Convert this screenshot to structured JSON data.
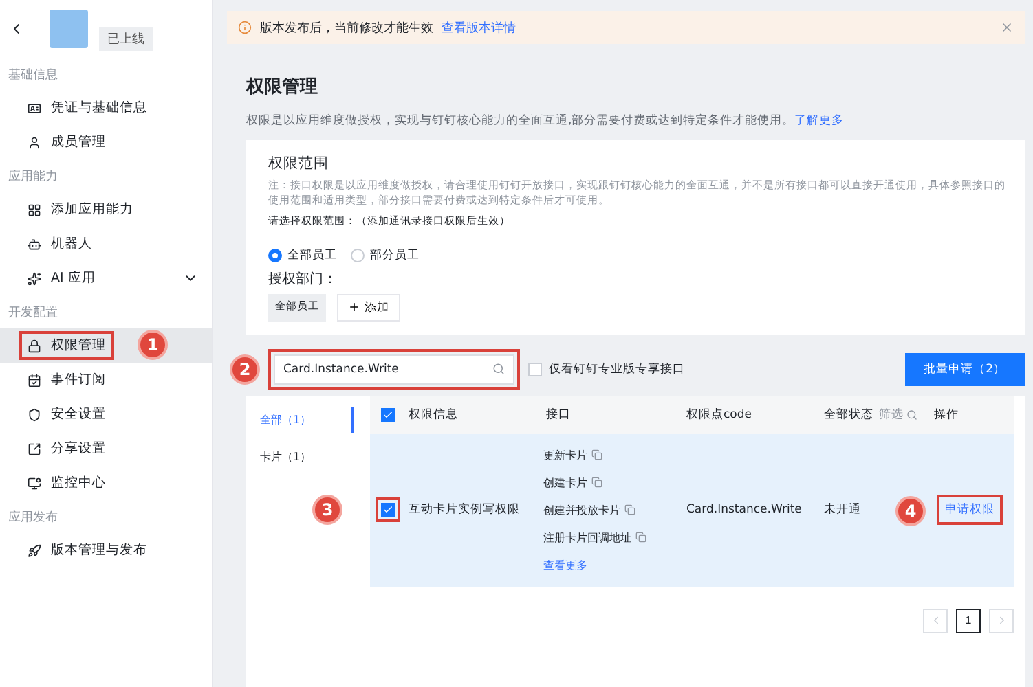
{
  "sidebar": {
    "app_status": "已上线",
    "sections": [
      {
        "title": "基础信息",
        "items": [
          {
            "label": "凭证与基础信息",
            "selected": false
          },
          {
            "label": "成员管理",
            "selected": false
          }
        ]
      },
      {
        "title": "应用能力",
        "items": [
          {
            "label": "添加应用能力",
            "selected": false
          },
          {
            "label": "机器人",
            "selected": false
          },
          {
            "label": "AI 应用",
            "selected": false,
            "expanded": false
          }
        ]
      },
      {
        "title": "开发配置",
        "items": [
          {
            "label": "权限管理",
            "selected": true,
            "callout": "1"
          },
          {
            "label": "事件订阅",
            "selected": false
          },
          {
            "label": "安全设置",
            "selected": false
          },
          {
            "label": "分享设置",
            "selected": false
          },
          {
            "label": "监控中心",
            "selected": false
          }
        ]
      },
      {
        "title": "应用发布",
        "items": [
          {
            "label": "版本管理与发布",
            "selected": false
          }
        ]
      }
    ]
  },
  "notice": {
    "text": "版本发布后，当前修改才能生效",
    "link": "查看版本详情"
  },
  "page": {
    "title": "权限管理",
    "description": "权限是以应用维度做授权，实现与钉钉核心能力的全面互通,部分需要付费或达到特定条件才能使用。",
    "link": "了解更多"
  },
  "scope": {
    "title": "权限范围",
    "note": "注：接口权限是以应用维度做授权，请合理使用钉钉开放接口，实现跟钉钉核心能力的全面互通，并不是所有接口都可以直接开通使用，具体参照接口的使用范围和适用类型，部分接口需要付费或达到特定条件后才可使用。",
    "prompt": "请选择权限范围：（添加通讯录接口权限后生效）",
    "options": [
      {
        "label": "全部员工",
        "selected": true
      },
      {
        "label": "部分员工",
        "selected": false
      }
    ],
    "dept_label": "授权部门：",
    "dept_tags": [
      "全部员工"
    ],
    "add_button": "添加"
  },
  "filter": {
    "search_value": "Card.Instance.Write",
    "callout": "2",
    "pro_only": {
      "label": "仅看钉钉专业版专享接口",
      "checked": false
    },
    "batch_button": "批量申请（2）"
  },
  "categories": [
    {
      "label": "全部（1）",
      "selected": true
    },
    {
      "label": "卡片（1）",
      "selected": false
    }
  ],
  "table": {
    "header_checked": true,
    "columns": [
      "权限信息",
      "接口",
      "权限点code",
      "全部状态",
      "操作"
    ],
    "status_filter": "筛选",
    "rows": [
      {
        "checked": true,
        "callout": "3",
        "info": "互动卡片实例写权限",
        "interfaces": [
          "更新卡片",
          "创建卡片",
          "创建并投放卡片",
          "注册卡片回调地址"
        ],
        "more": "查看更多",
        "code": "Card.Instance.Write",
        "status": "未开通",
        "action": "申请权限",
        "action_callout": "4"
      }
    ]
  },
  "pagination": {
    "pages": [
      {
        "label": "1",
        "selected": true
      }
    ]
  }
}
